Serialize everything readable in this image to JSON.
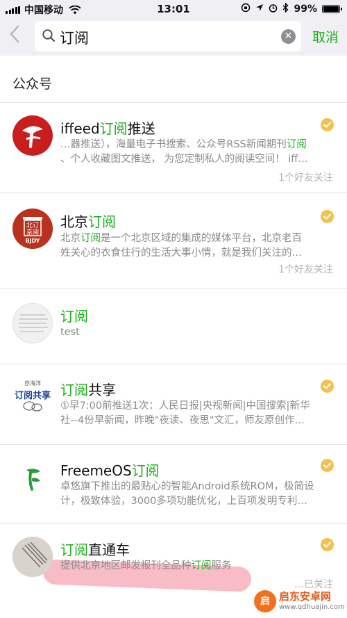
{
  "status_bar": {
    "carrier": "中国移动",
    "time": "13:01",
    "battery_text": "99%",
    "battery_level": 0.99
  },
  "search": {
    "query": "订阅",
    "cancel_label": "取消"
  },
  "section": {
    "title": "公众号"
  },
  "results": [
    {
      "title_pre": "iffeed",
      "title_hl": "订阅",
      "title_post": "推送",
      "desc_line1_pre": "…器推送），海量电子书搜索、公众号RSS新闻期刊",
      "desc_line1_hl": "订阅",
      "desc_line1_post": "",
      "desc_line2": "、个人收藏图文推送，  为您定制私人的阅读空间！  iff…",
      "friends": "1个好友关注",
      "verified": true,
      "avatar_icon": "iffeed-logo"
    },
    {
      "title_pre": "北京",
      "title_hl": "订阅",
      "title_post": "",
      "desc_line1_pre": "北京",
      "desc_line1_hl": "订阅",
      "desc_line1_post": "是一个北京区域的集成的媒体平台，北京老百",
      "desc_line2": "姓关心的衣食住行的生活大事小情，就是我们关注的…",
      "friends": "1个好友关注",
      "verified": true,
      "avatar_icon": "beijing-dingyue-logo",
      "avatar_text": "北订京阅",
      "avatar_sub": "BJDY"
    },
    {
      "title_pre": "",
      "title_hl": "订阅",
      "title_post": "",
      "desc_line1_pre": "test",
      "desc_line1_hl": "",
      "desc_line1_post": "",
      "desc_line2": "",
      "friends": "",
      "verified": false,
      "avatar_icon": "blurry-document-avatar"
    },
    {
      "title_pre": "",
      "title_hl": "订阅",
      "title_post": "共享",
      "desc_line1_pre": "①早7:00前推送1次：人民日报|央视新闻|中国搜索|新华",
      "desc_line1_hl": "",
      "desc_line1_post": "",
      "desc_line2": "社--4份早新闻，昨晚\"夜读、夜思\"文汇，师友原创作…",
      "friends": "",
      "verified": true,
      "avatar_icon": "dingyue-gongxiang-logo",
      "avatar_text": "订阅共享",
      "avatar_sub": "亦海洋"
    },
    {
      "title_pre": "FreemeOS",
      "title_hl": "订阅",
      "title_post": "",
      "desc_line1_pre": "卓悠旗下推出的最贴心的智能Android系统ROM，极简设",
      "desc_line1_hl": "",
      "desc_line1_post": "",
      "desc_line2": "计，极致体验，3000多项功能优化，上百项发明专利…",
      "friends": "",
      "verified": true,
      "avatar_icon": "freemeos-leaf-logo"
    },
    {
      "title_pre": "",
      "title_hl": "订阅",
      "title_post": "直通车",
      "desc_line1_pre": "提供北京地区邮发报刊全品种",
      "desc_line1_hl": "订阅",
      "desc_line1_post": "服务",
      "desc_line2": "",
      "friends": "…已关注",
      "verified": true,
      "avatar_icon": "newspaper-photo-avatar"
    }
  ],
  "watermark": {
    "name": "启东安卓网",
    "url": "www.qdhuajin.com",
    "logo_char": "启"
  },
  "colors": {
    "accent_green": "#1aad19",
    "badge_gold": "#f1c24d",
    "secondary_text": "#8a8a8a",
    "header_bg": "#efeff4"
  }
}
